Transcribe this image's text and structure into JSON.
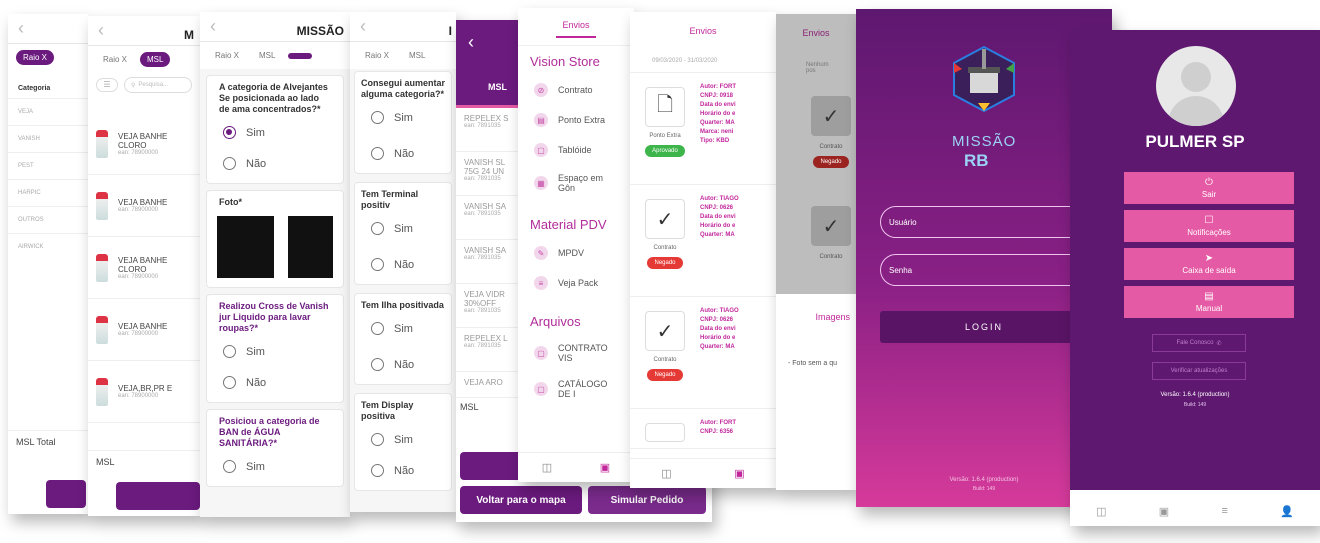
{
  "screen1": {
    "tab_active": "Raio X",
    "column_header": "Categoria",
    "categories": [
      "VEJA",
      "VANISH",
      "PEST",
      "HARPIC",
      "OUTROS",
      "AIRWICK"
    ],
    "footer_label": "MSL Total"
  },
  "screen2": {
    "title": "M",
    "tabs": [
      "Raio X",
      "MSL"
    ],
    "search_placeholder": "Pesquisa...",
    "products": [
      {
        "name": "VEJA BANHE CLORO"
      },
      {
        "name": "VEJA BANHE"
      },
      {
        "name": "VEJA BANHE CLORO"
      },
      {
        "name": "VEJA BANHE"
      },
      {
        "name": "VEJA,BR,PR E"
      }
    ],
    "footer_label": "MSL"
  },
  "screen3": {
    "title": "MISSÃO",
    "tabs": [
      "Raio X",
      "MSL"
    ],
    "q1": "A categoria de Alvejantes Se posicionada ao lado de ama concentrados?*",
    "opt_sim": "Sim",
    "opt_nao": "Não",
    "photo_label": "Foto*",
    "q2": "Realizou Cross de Vanish jur Liquido para lavar roupas?*",
    "q3": "Posiciou a categoria de BAN de ÁGUA SANITÁRIA?*"
  },
  "screen4": {
    "tabs": [
      "Raio X",
      "MSL"
    ],
    "q1": "Consegui aumentar alguma categoria?*",
    "q2": "Tem Terminal positiv",
    "q3": "Tem Ilha positivada",
    "q4": "Tem Display positiva",
    "opt_sim": "Sim",
    "opt_nao": "Não"
  },
  "screen5": {
    "tab_label": "MSL",
    "items": [
      "REPELEX S",
      "VANISH SL 75G 24 UN",
      "VANISH SA",
      "VANISH SA",
      "VEJA VIDR 30%OFF",
      "REPELEX L",
      "VEJA ARO"
    ],
    "footer_label": "MSL",
    "btn_map": "Voltar para o mapa",
    "btn_simulate": "Simular Pedido"
  },
  "screen6": {
    "header": "Envios",
    "section1": "Vision Store",
    "section1_items": [
      "Contrato",
      "Ponto Extra",
      "Tablóide",
      "Espaço em Gôn"
    ],
    "section2": "Material PDV",
    "section2_items": [
      "MPDV",
      "Veja Pack"
    ],
    "section3": "Arquivos",
    "section3_items": [
      "CONTRATO VIS",
      "CATÁLOGO DE I"
    ]
  },
  "screen7": {
    "header": "Envios",
    "date_range": "09/03/2020 - 31/03/2020",
    "entries": [
      {
        "type": "Ponto Extra",
        "status": "Aprovado",
        "status_color": "#3db54a",
        "lines": [
          "Autor: FORT",
          "CNPJ: 0918",
          "Data do envi",
          "Horário do e",
          "Quarter: MA",
          "Marca: neni",
          "Tipo: KBD"
        ]
      },
      {
        "type": "Contrato",
        "status": "Negado",
        "status_color": "#e53935",
        "lines": [
          "Autor: TIAGO",
          "CNPJ: 0626",
          "Data do envi",
          "Horário do e",
          "Quarter: MA"
        ]
      },
      {
        "type": "Contrato",
        "status": "Negado",
        "status_color": "#e53935",
        "lines": [
          "Autor: TIAGO",
          "CNPJ: 0626",
          "Data do envi",
          "Horário do e",
          "Quarter: MA"
        ]
      },
      {
        "type": "",
        "status": "",
        "status_color": "#e53935",
        "lines": [
          "Autor: FORT",
          "CNPJ: 6356"
        ]
      }
    ]
  },
  "screen8": {
    "header": "Envios",
    "sub": "Nenhum pos",
    "entries": [
      {
        "type": "Contrato",
        "status": "Negado"
      },
      {
        "type": "Contrato",
        "status": ""
      }
    ],
    "modal_title": "Imagens",
    "modal_text": "- Foto sem a qu"
  },
  "screen9": {
    "logo_text_1": "MISSÃO",
    "logo_text_2": "RB",
    "username_placeholder": "Usuário",
    "password_placeholder": "Senha",
    "login_label": "LOGIN",
    "version": "Versão: 1.6.4 (production)",
    "build": "Build: 149"
  },
  "screen10": {
    "title": "PULMER SP",
    "buttons": [
      {
        "label": "Sair",
        "icon": "logout-icon",
        "glyph": "⏻"
      },
      {
        "label": "Notificações",
        "icon": "notification-icon",
        "glyph": "☐"
      },
      {
        "label": "Caixa de saída",
        "icon": "send-icon",
        "glyph": "➤"
      },
      {
        "label": "Manual",
        "icon": "manual-icon",
        "glyph": "▤"
      }
    ],
    "contact": "Fale Conosco",
    "update": "Verificar atualizações",
    "version": "Versão: 1.6.4 (production)",
    "build": "Build: 149"
  }
}
